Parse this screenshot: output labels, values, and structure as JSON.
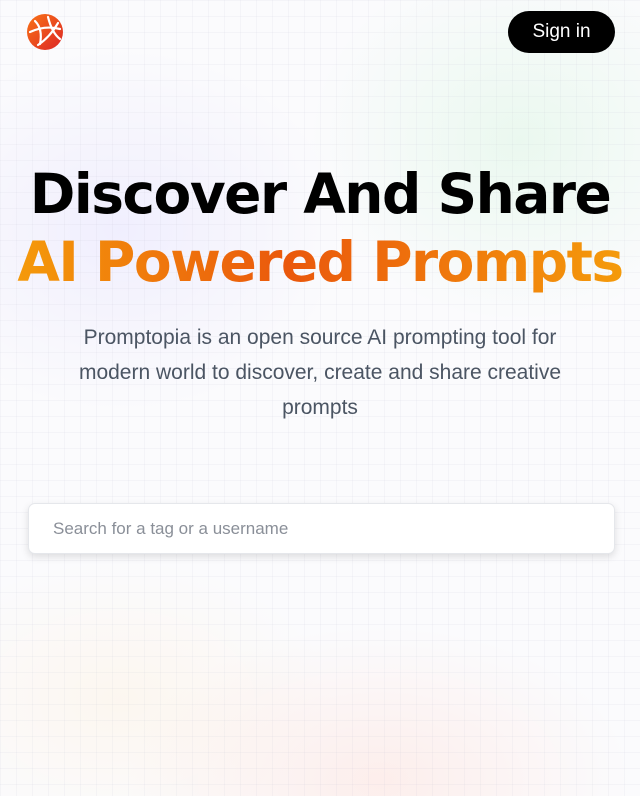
{
  "nav": {
    "logo_icon": "globe-network-icon",
    "sign_in_label": "Sign in"
  },
  "hero": {
    "title_line1": "Discover And Share",
    "title_line2": "AI Powered Prompts",
    "description": "Promptopia is an open source AI prompting tool for modern world to discover, create and share creative prompts"
  },
  "search": {
    "placeholder": "Search for a tag or a username",
    "value": ""
  },
  "colors": {
    "accent_orange": "#ea580c",
    "accent_amber": "#f59e0b",
    "button_bg": "#000000"
  }
}
